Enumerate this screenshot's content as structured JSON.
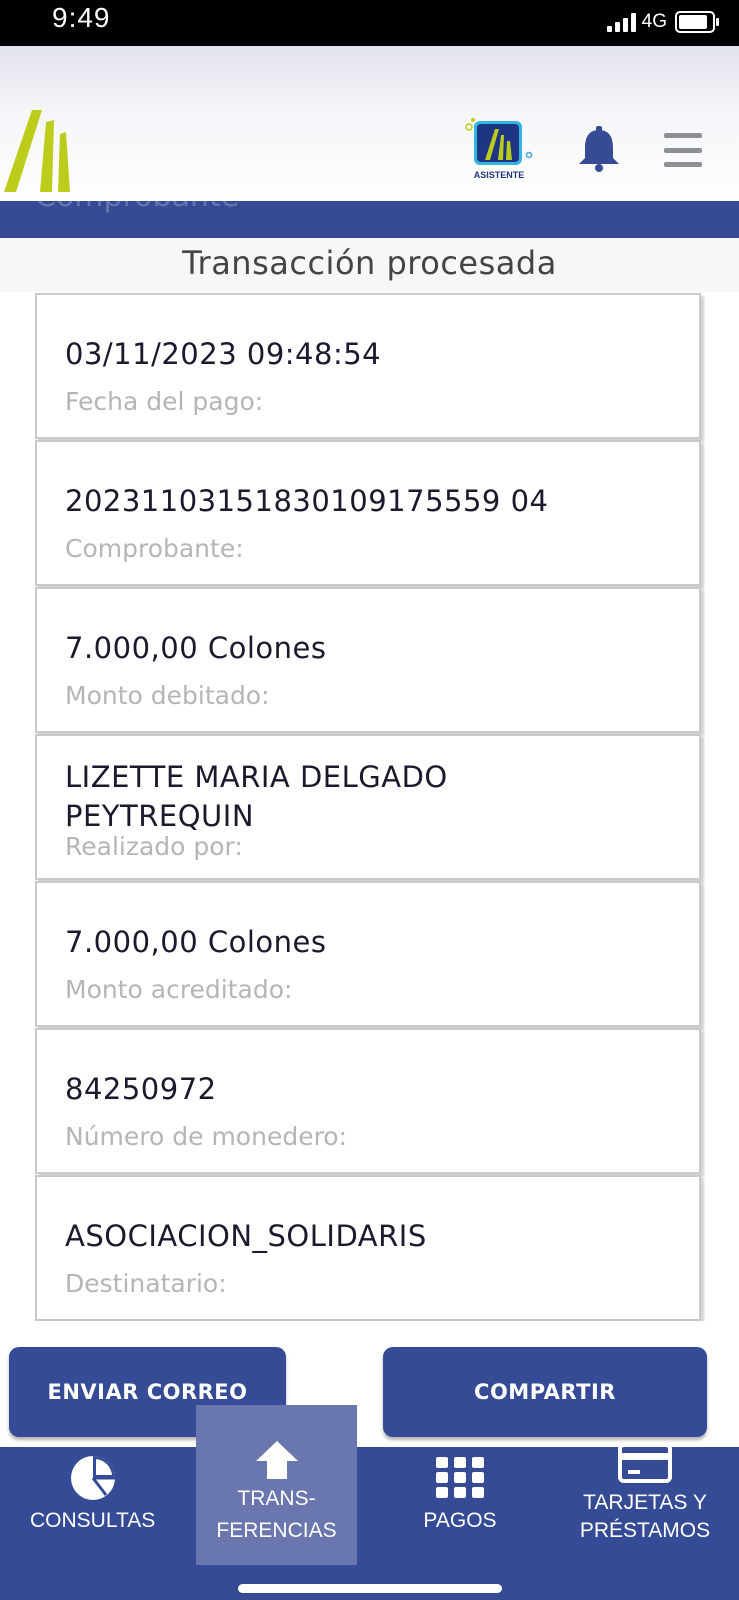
{
  "status_bar": {
    "time": "9:49",
    "network": "4G"
  },
  "header": {
    "asistente_label": "ASISTENTE"
  },
  "page": {
    "ghost_title": "Comprobante",
    "processed_title": "Transacción procesada"
  },
  "details": [
    {
      "value": "03/11/2023 09:48:54",
      "label": "Fecha del pago:"
    },
    {
      "value": "20231103151830109175559 04",
      "label": "Comprobante:"
    },
    {
      "value": "7.000,00 Colones",
      "label": "Monto debitado:"
    },
    {
      "value": "LIZETTE MARIA DELGADO PEYTREQUIN",
      "label": "Realizado por:"
    },
    {
      "value": "7.000,00 Colones",
      "label": "Monto acreditado:"
    },
    {
      "value": "84250972",
      "label": "Número de monedero:"
    },
    {
      "value": "ASOCIACION_SOLIDARIS",
      "label": "Destinatario:"
    }
  ],
  "actions": {
    "email_label": "ENVIAR CORREO",
    "share_label": "COMPARTIR"
  },
  "nav": {
    "consultas": "CONSULTAS",
    "transferencias_1": "TRANS-",
    "transferencias_2": "FERENCIAS",
    "pagos": "PAGOS",
    "tarjetas_1": "TARJETAS Y",
    "tarjetas_2": "PRÉSTAMOS"
  },
  "colors": {
    "primary": "#364b95",
    "active_nav": "#6a76ae",
    "logo_yellow": "#bccc1a"
  }
}
